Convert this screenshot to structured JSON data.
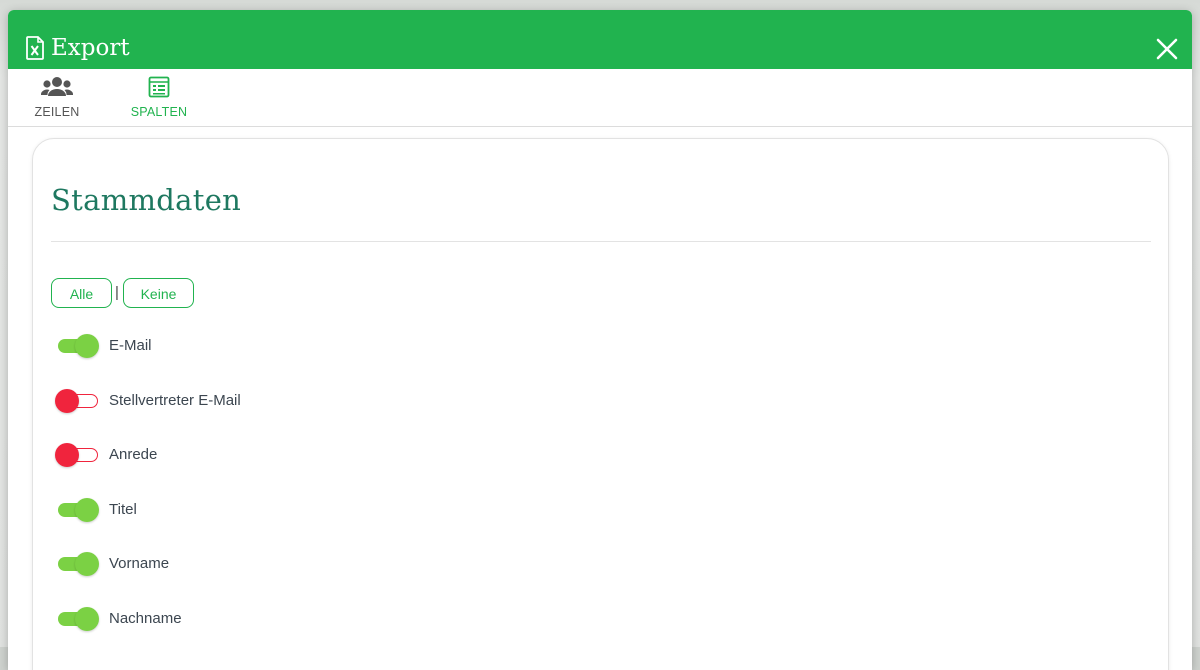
{
  "dialog": {
    "title": "Export",
    "title_icon": "excel-file-icon",
    "close_icon": "close-icon"
  },
  "tabs": [
    {
      "label": "ZEILEN",
      "icon": "users-icon",
      "active": false
    },
    {
      "label": "SPALTEN",
      "icon": "table-list-icon",
      "active": true
    }
  ],
  "section": {
    "title": "Stammdaten",
    "select_all_label": "Alle",
    "separator": "|",
    "select_none_label": "Keine"
  },
  "fields": [
    {
      "label": "E-Mail",
      "enabled": true
    },
    {
      "label": "Stellvertreter E-Mail",
      "enabled": false
    },
    {
      "label": "Anrede",
      "enabled": false
    },
    {
      "label": "Titel",
      "enabled": true
    },
    {
      "label": "Vorname",
      "enabled": true
    },
    {
      "label": "Nachname",
      "enabled": true
    }
  ],
  "colors": {
    "header_green": "#21b34f",
    "toggle_on": "#7bd144",
    "toggle_off": "#f0243d",
    "title_teal": "#1e7860"
  }
}
